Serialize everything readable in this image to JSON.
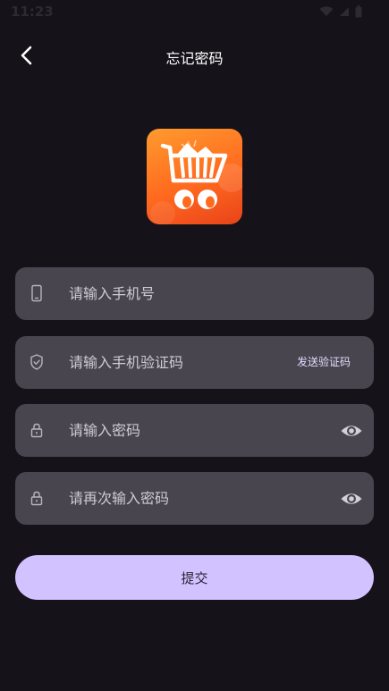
{
  "status_bar": {
    "time": "11:23"
  },
  "header": {
    "title": "忘记密码"
  },
  "form": {
    "phone_placeholder": "请输入手机号",
    "code_placeholder": "请输入手机验证码",
    "send_code_label": "发送验证码",
    "password_placeholder": "请输入密码",
    "confirm_password_placeholder": "请再次输入密码"
  },
  "submit_label": "提交",
  "colors": {
    "background": "#15121a",
    "field_bg": "#48454e",
    "accent": "#d2c2ff",
    "logo_orange": "#ff6a1f"
  },
  "icons": {
    "back": "chevron-left-icon",
    "phone": "phone-icon",
    "code": "shield-icon",
    "password": "lock-icon",
    "visibility": "eye-icon",
    "logo": "shopping-cart-icon"
  }
}
